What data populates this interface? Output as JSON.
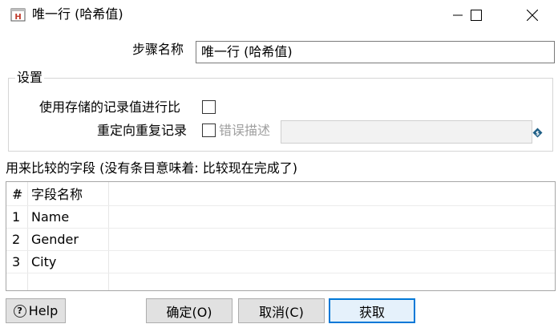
{
  "window": {
    "title": "唯一行 (哈希值)",
    "icon": "hash-step-icon",
    "controls": [
      "minimize-icon",
      "maximize-icon",
      "close-icon"
    ]
  },
  "step_name": {
    "label": "步骤名称",
    "value": "唯一行 (哈希值)"
  },
  "settings": {
    "group_title": "设置",
    "compare_stored_label": "使用存储的记录值进行比",
    "compare_stored_checked": false,
    "redirect_label": "重定向重复记录",
    "redirect_checked": false,
    "error_desc_label": "错误描述",
    "error_desc_value": "",
    "variable_icon": "variable-diamond-icon"
  },
  "fields": {
    "label": "用来比较的字段 (没有条目意味着: 比较现在完成了)",
    "columns": {
      "num": "#",
      "name": "字段名称"
    },
    "rows": [
      {
        "num": "1",
        "name": "Name"
      },
      {
        "num": "2",
        "name": "Gender"
      },
      {
        "num": "3",
        "name": "City"
      }
    ]
  },
  "buttons": {
    "help": "Help",
    "ok": "确定(O)",
    "cancel": "取消(C)",
    "get": "获取"
  },
  "colors": {
    "accent": "#0078d7",
    "button_bg": "#e1e1e1",
    "disabled_text": "#a0a0a0"
  }
}
